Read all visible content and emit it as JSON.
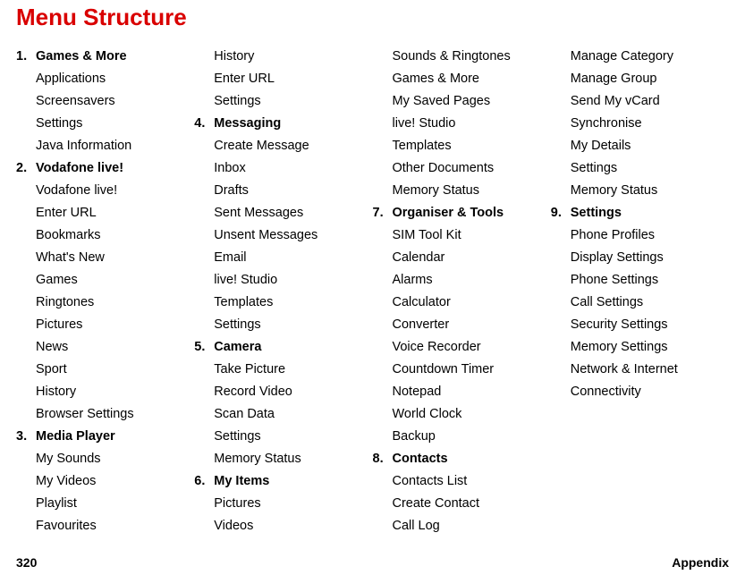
{
  "title": "Menu Structure",
  "footer_left": "320",
  "footer_right": "Appendix",
  "columns": [
    [
      {
        "num": "1.",
        "label": "Games & More",
        "header": true
      },
      {
        "num": "",
        "label": "Applications",
        "header": false
      },
      {
        "num": "",
        "label": "Screensavers",
        "header": false
      },
      {
        "num": "",
        "label": "Settings",
        "header": false
      },
      {
        "num": "",
        "label": "Java Information",
        "header": false
      },
      {
        "num": "2.",
        "label": "Vodafone live!",
        "header": true
      },
      {
        "num": "",
        "label": "Vodafone live!",
        "header": false
      },
      {
        "num": "",
        "label": "Enter URL",
        "header": false
      },
      {
        "num": "",
        "label": "Bookmarks",
        "header": false
      },
      {
        "num": "",
        "label": "What's New",
        "header": false
      },
      {
        "num": "",
        "label": "Games",
        "header": false
      },
      {
        "num": "",
        "label": "Ringtones",
        "header": false
      },
      {
        "num": "",
        "label": "Pictures",
        "header": false
      },
      {
        "num": "",
        "label": "News",
        "header": false
      },
      {
        "num": "",
        "label": "Sport",
        "header": false
      },
      {
        "num": "",
        "label": "History",
        "header": false
      },
      {
        "num": "",
        "label": "Browser Settings",
        "header": false
      },
      {
        "num": "3.",
        "label": "Media Player",
        "header": true
      },
      {
        "num": "",
        "label": "My Sounds",
        "header": false
      },
      {
        "num": "",
        "label": "My Videos",
        "header": false
      },
      {
        "num": "",
        "label": "Playlist",
        "header": false
      },
      {
        "num": "",
        "label": "Favourites",
        "header": false
      }
    ],
    [
      {
        "num": "",
        "label": "History",
        "header": false
      },
      {
        "num": "",
        "label": "Enter URL",
        "header": false
      },
      {
        "num": "",
        "label": "Settings",
        "header": false
      },
      {
        "num": "4.",
        "label": "Messaging",
        "header": true
      },
      {
        "num": "",
        "label": "Create Message",
        "header": false
      },
      {
        "num": "",
        "label": "Inbox",
        "header": false
      },
      {
        "num": "",
        "label": "Drafts",
        "header": false
      },
      {
        "num": "",
        "label": "Sent Messages",
        "header": false
      },
      {
        "num": "",
        "label": "Unsent Messages",
        "header": false
      },
      {
        "num": "",
        "label": "Email",
        "header": false
      },
      {
        "num": "",
        "label": "live! Studio",
        "header": false
      },
      {
        "num": "",
        "label": "Templates",
        "header": false
      },
      {
        "num": "",
        "label": "Settings",
        "header": false
      },
      {
        "num": "5.",
        "label": "Camera",
        "header": true
      },
      {
        "num": "",
        "label": "Take Picture",
        "header": false
      },
      {
        "num": "",
        "label": "Record Video",
        "header": false
      },
      {
        "num": "",
        "label": "Scan Data",
        "header": false
      },
      {
        "num": "",
        "label": "Settings",
        "header": false
      },
      {
        "num": "",
        "label": "Memory Status",
        "header": false
      },
      {
        "num": "6.",
        "label": "My Items",
        "header": true
      },
      {
        "num": "",
        "label": "Pictures",
        "header": false
      },
      {
        "num": "",
        "label": "Videos",
        "header": false
      }
    ],
    [
      {
        "num": "",
        "label": "Sounds & Ringtones",
        "header": false
      },
      {
        "num": "",
        "label": "Games & More",
        "header": false
      },
      {
        "num": "",
        "label": "My Saved Pages",
        "header": false
      },
      {
        "num": "",
        "label": "live! Studio",
        "header": false
      },
      {
        "num": "",
        "label": "Templates",
        "header": false
      },
      {
        "num": "",
        "label": "Other Documents",
        "header": false
      },
      {
        "num": "",
        "label": "Memory Status",
        "header": false
      },
      {
        "num": "7.",
        "label": "Organiser & Tools",
        "header": true
      },
      {
        "num": "",
        "label": "SIM Tool Kit",
        "header": false
      },
      {
        "num": "",
        "label": "Calendar",
        "header": false
      },
      {
        "num": "",
        "label": "Alarms",
        "header": false
      },
      {
        "num": "",
        "label": "Calculator",
        "header": false
      },
      {
        "num": "",
        "label": "Converter",
        "header": false
      },
      {
        "num": "",
        "label": "Voice Recorder",
        "header": false
      },
      {
        "num": "",
        "label": "Countdown Timer",
        "header": false
      },
      {
        "num": "",
        "label": "Notepad",
        "header": false
      },
      {
        "num": "",
        "label": "World Clock",
        "header": false
      },
      {
        "num": "",
        "label": "Backup",
        "header": false
      },
      {
        "num": "8.",
        "label": "Contacts",
        "header": true
      },
      {
        "num": "",
        "label": "Contacts List",
        "header": false
      },
      {
        "num": "",
        "label": "Create Contact",
        "header": false
      },
      {
        "num": "",
        "label": "Call Log",
        "header": false
      }
    ],
    [
      {
        "num": "",
        "label": "Manage Category",
        "header": false
      },
      {
        "num": "",
        "label": "Manage Group",
        "header": false
      },
      {
        "num": "",
        "label": "Send My vCard",
        "header": false
      },
      {
        "num": "",
        "label": "Synchronise",
        "header": false
      },
      {
        "num": "",
        "label": "My Details",
        "header": false
      },
      {
        "num": "",
        "label": "Settings",
        "header": false
      },
      {
        "num": "",
        "label": "Memory Status",
        "header": false
      },
      {
        "num": "9.",
        "label": "Settings",
        "header": true
      },
      {
        "num": "",
        "label": "Phone Profiles",
        "header": false
      },
      {
        "num": "",
        "label": "Display Settings",
        "header": false
      },
      {
        "num": "",
        "label": "Phone Settings",
        "header": false
      },
      {
        "num": "",
        "label": "Call Settings",
        "header": false
      },
      {
        "num": "",
        "label": "Security Settings",
        "header": false
      },
      {
        "num": "",
        "label": "Memory Settings",
        "header": false
      },
      {
        "num": "",
        "label": "Network & Internet",
        "header": false
      },
      {
        "num": "",
        "label": "Connectivity",
        "header": false
      }
    ]
  ]
}
